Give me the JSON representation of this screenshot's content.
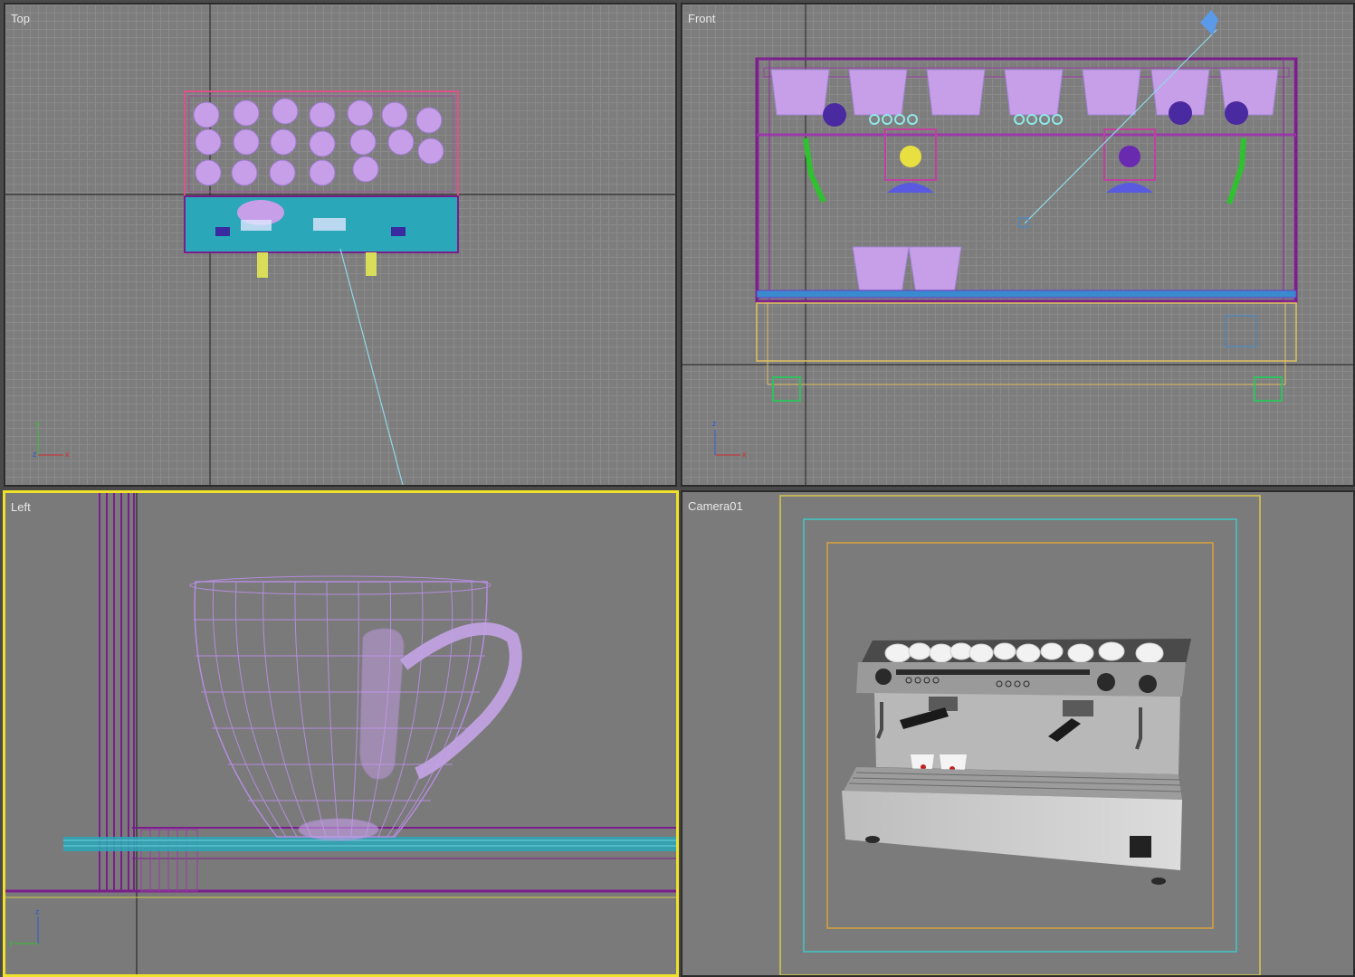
{
  "viewports": {
    "top": {
      "label": "Top"
    },
    "front": {
      "label": "Front"
    },
    "left": {
      "label": "Left",
      "active": true
    },
    "camera": {
      "label": "Camera01"
    }
  },
  "axes": {
    "top": {
      "h": "x",
      "v": "y",
      "origin": "z"
    },
    "front": {
      "h": "x",
      "v": "z"
    },
    "left": {
      "v": "z",
      "h": "y"
    }
  },
  "colors": {
    "active_border": "#f0e22a",
    "wire_purple": "#b48cdc",
    "frame_purple": "#7a1e8c",
    "cyan_tray": "#2aa7b8",
    "safe_frame_cyan": "#3fc7c7",
    "safe_frame_orange": "#d9a23a",
    "safe_frame_yellow": "#d8c84a"
  }
}
